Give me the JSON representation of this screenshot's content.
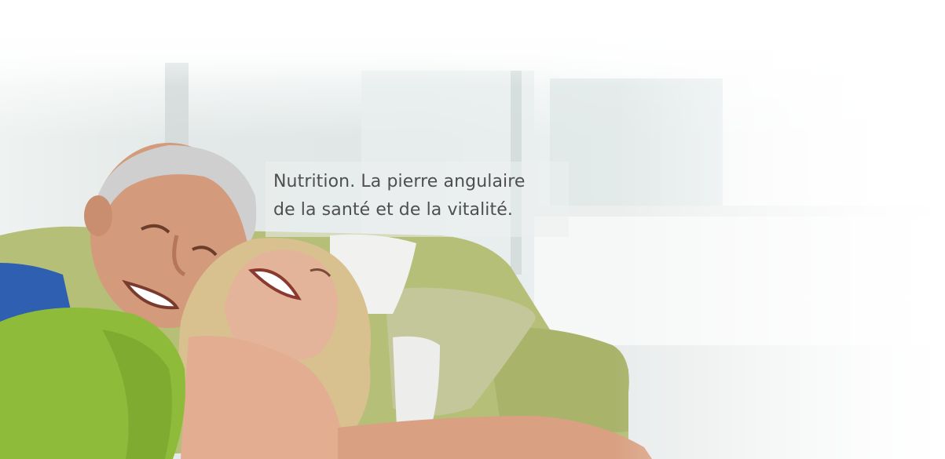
{
  "hero": {
    "tagline_line1": "Nutrition. La pierre angulaire",
    "tagline_line2": "de la santé et de la vitalité.",
    "colors": {
      "text": "#4f4f4f",
      "sofa": "#b6bf78",
      "shirt_green": "#8fbb3a",
      "shirt_blue": "#2e5fb0",
      "background": "#e6ecec"
    }
  }
}
